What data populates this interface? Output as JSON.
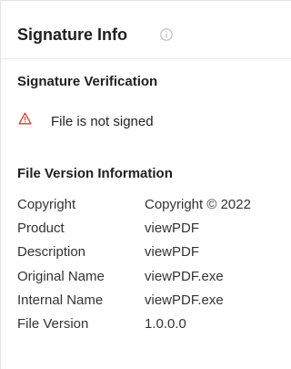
{
  "header": {
    "title": "Signature Info",
    "info_icon": "info-circle-icon"
  },
  "signature_verification": {
    "title": "Signature Verification",
    "status_icon": "warning-triangle-icon",
    "status_color": "#e53935",
    "status_text": "File is not signed"
  },
  "file_version_information": {
    "title": "File Version Information",
    "rows": [
      {
        "key": "Copyright",
        "value": "Copyright © 2022"
      },
      {
        "key": "Product",
        "value": "viewPDF"
      },
      {
        "key": "Description",
        "value": "viewPDF"
      },
      {
        "key": "Original Name",
        "value": "viewPDF.exe"
      },
      {
        "key": "Internal Name",
        "value": "viewPDF.exe"
      },
      {
        "key": "File Version",
        "value": "1.0.0.0"
      }
    ]
  }
}
